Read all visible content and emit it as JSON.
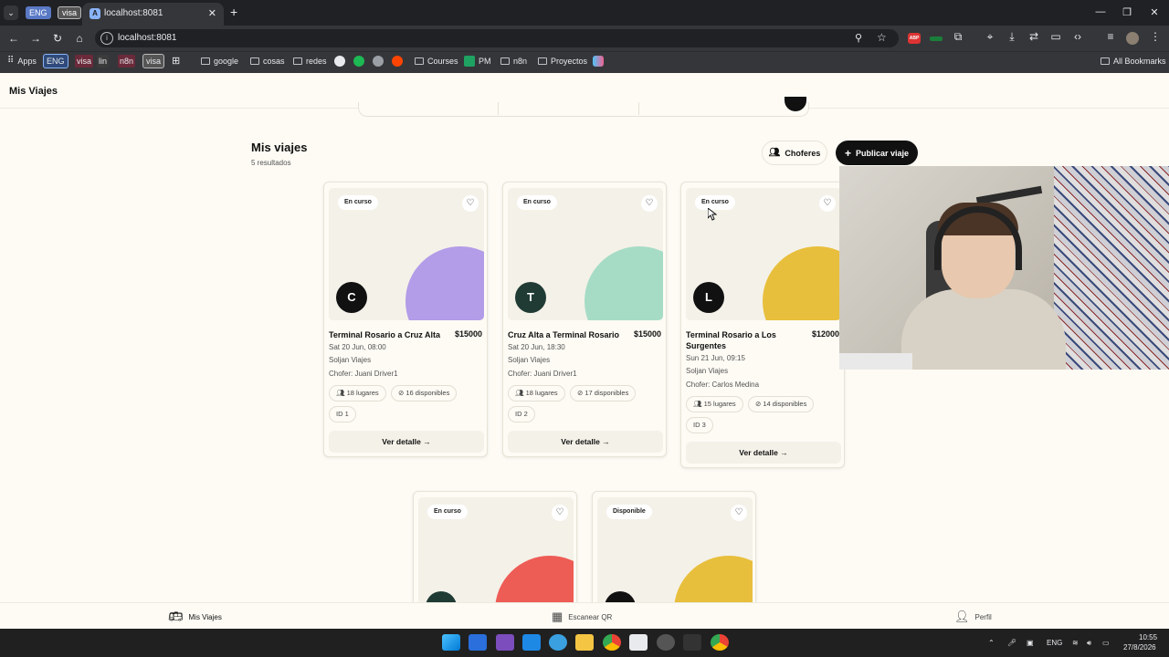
{
  "browser": {
    "tab_chips": [
      "ENG",
      "visa"
    ],
    "tab_title": "localhost:8081",
    "url": "localhost:8081",
    "bookmarks": [
      {
        "label": "Apps",
        "type": "apps"
      },
      {
        "label": "ENG",
        "type": "chip"
      },
      {
        "label": "visa",
        "type": "text"
      },
      {
        "label": "lin",
        "type": "text"
      },
      {
        "label": "n8n",
        "type": "text"
      },
      {
        "label": "visa",
        "type": "chip"
      },
      {
        "label": "google",
        "type": "folder"
      },
      {
        "label": "cosas",
        "type": "folder"
      },
      {
        "label": "redes",
        "type": "folder"
      },
      {
        "label": "Courses",
        "type": "folder"
      },
      {
        "label": "PM",
        "type": "icon"
      },
      {
        "label": "n8n",
        "type": "folder"
      },
      {
        "label": "Proyectos",
        "type": "folder"
      }
    ],
    "all_bookmarks": "All Bookmarks"
  },
  "app": {
    "title": "Mis Viajes",
    "heading": "Mis viajes",
    "results": "5 resultados",
    "btn_choferes": "Choferes",
    "btn_publicar": "Publicar viaje",
    "detail_label": "Ver detalle"
  },
  "trips": [
    {
      "status": "En curso",
      "initial": "C",
      "avatar_color": "#111111",
      "blob_color": "#b39ce8",
      "title": "Terminal Rosario a Cruz Alta",
      "price": "$15000",
      "date": "Sat 20 Jun, 08:00",
      "company": "Soljan Viajes",
      "driver": "Chofer: Juani Driver1",
      "seats": "18 lugares",
      "available": "16 disponibles",
      "id": "ID 1"
    },
    {
      "status": "En curso",
      "initial": "T",
      "avatar_color": "#1f3b34",
      "blob_color": "#a6dcc5",
      "title": "Cruz Alta a Terminal Rosario",
      "price": "$15000",
      "date": "Sat 20 Jun, 18:30",
      "company": "Soljan Viajes",
      "driver": "Chofer: Juani Driver1",
      "seats": "18 lugares",
      "available": "17 disponibles",
      "id": "ID 2"
    },
    {
      "status": "En curso",
      "initial": "L",
      "avatar_color": "#111111",
      "blob_color": "#e8bf3c",
      "title": "Terminal Rosario a Los Surgentes",
      "price": "$12000",
      "date": "Sun 21 Jun, 09:15",
      "company": "Soljan Viajes",
      "driver": "Chofer: Carlos Medina",
      "seats": "15 lugares",
      "available": "14 disponibles",
      "id": "ID 3"
    },
    {
      "status": "En curso",
      "initial": "",
      "avatar_color": "#1f3b34",
      "blob_color": "#ee5c56"
    },
    {
      "status": "Disponible",
      "initial": "",
      "avatar_color": "#111111",
      "blob_color": "#e8bf3c"
    }
  ],
  "bottom_nav": [
    "Mis Viajes",
    "Escanear QR",
    "Perfil"
  ],
  "taskbar": {
    "lang": "ENG",
    "time": "10:55",
    "date": "27/8/2026"
  }
}
